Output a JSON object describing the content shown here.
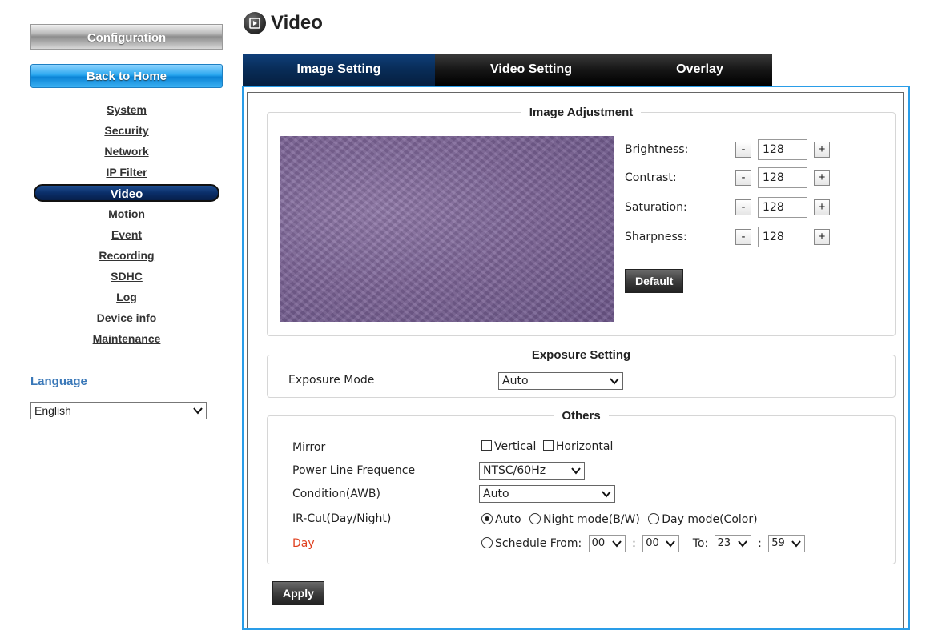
{
  "sidebar": {
    "config_title": "Configuration",
    "back_home": "Back to Home",
    "items": [
      {
        "label": "System"
      },
      {
        "label": "Security"
      },
      {
        "label": "Network"
      },
      {
        "label": "IP Filter"
      },
      {
        "label": "Video",
        "active": true
      },
      {
        "label": "Motion"
      },
      {
        "label": "Event"
      },
      {
        "label": "Recording"
      },
      {
        "label": "SDHC"
      },
      {
        "label": "Log"
      },
      {
        "label": "Device info"
      },
      {
        "label": "Maintenance"
      }
    ],
    "language_label": "Language",
    "language_value": "English"
  },
  "header": {
    "title": "Video",
    "icon": "film-icon"
  },
  "tabs": [
    {
      "label": "Image Setting",
      "active": true
    },
    {
      "label": "Video Setting"
    },
    {
      "label": "Overlay"
    }
  ],
  "image_adjustment": {
    "legend": "Image Adjustment",
    "params": [
      {
        "label": "Brightness:",
        "value": "128"
      },
      {
        "label": "Contrast:",
        "value": "128"
      },
      {
        "label": "Saturation:",
        "value": "128"
      },
      {
        "label": "Sharpness:",
        "value": "128"
      }
    ],
    "minus": "-",
    "plus": "+",
    "default_button": "Default"
  },
  "exposure": {
    "legend": "Exposure Setting",
    "mode_label": "Exposure Mode",
    "mode_value": "Auto"
  },
  "others": {
    "legend": "Others",
    "mirror_label": "Mirror",
    "mirror_vertical": "Vertical",
    "mirror_horizontal": "Horizontal",
    "power_label": "Power Line Frequence",
    "power_value": "NTSC/60Hz",
    "awb_label": "Condition(AWB)",
    "awb_value": "Auto",
    "ircut_label": "IR-Cut(Day/Night)",
    "ircut_auto": "Auto",
    "ircut_night": "Night mode(B/W)",
    "ircut_day": "Day mode(Color)",
    "day_label": "Day",
    "schedule_from": "Schedule From:",
    "from_hour": "00",
    "from_min": "00",
    "to_label": "To:",
    "to_hour": "23",
    "to_min": "59",
    "colon": ":"
  },
  "apply_button": "Apply",
  "colors": {
    "accent": "#2a9de8",
    "nav_active": "#0a2e69",
    "day_label": "#e0401f",
    "language_label": "#3a78b8"
  }
}
